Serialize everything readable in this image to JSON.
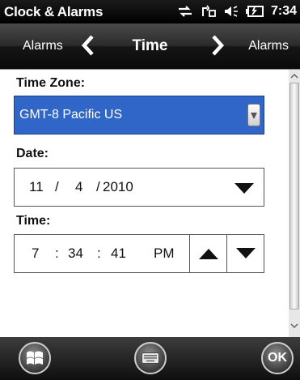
{
  "status": {
    "title": "Clock & Alarms",
    "time": "7:34",
    "icons": [
      "sync-icon",
      "connection-icon",
      "volume-icon",
      "battery-icon"
    ]
  },
  "nav": {
    "prev_label": "Alarms",
    "title": "Time",
    "next_label": "Alarms"
  },
  "form": {
    "timezone_label": "Time Zone:",
    "timezone_value": "GMT-8 Pacific US",
    "date_label": "Date:",
    "date": {
      "month": "11",
      "sep1": "/",
      "day": "4",
      "sep2": "/",
      "year": "2010"
    },
    "time_label": "Time:",
    "time": {
      "hour": "7",
      "sep1": ":",
      "minute": "34",
      "sep2": ":",
      "second": "41",
      "ampm": "PM"
    }
  },
  "softkeys": {
    "right_label": "OK",
    "icons": [
      "windows-start-icon",
      "keyboard-icon"
    ]
  },
  "colors": {
    "selection": "#2f66c8",
    "status_bg": "#000000",
    "content_bg": "#ffffff"
  }
}
